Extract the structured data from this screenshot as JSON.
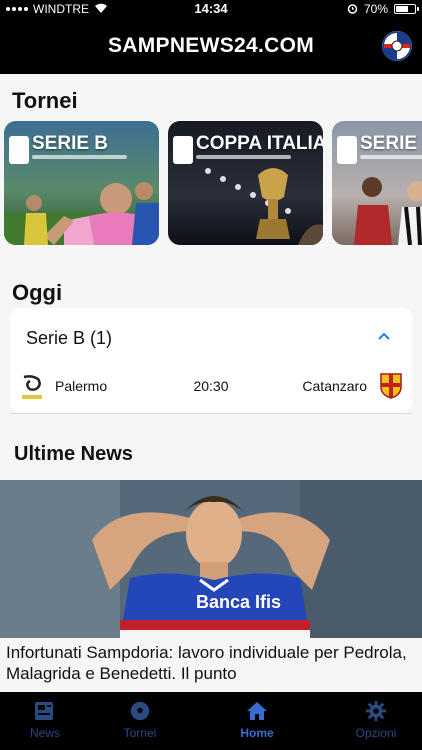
{
  "status_bar": {
    "carrier": "WINDTRE",
    "time": "14:34",
    "battery": "70%",
    "battery_level": 0.7
  },
  "header": {
    "title": "SAMPNEWS24.COM"
  },
  "tournaments": {
    "title": "Tornei",
    "cards": [
      {
        "label": "SERIE B"
      },
      {
        "label": "COPPA ITALIA"
      },
      {
        "label": "SERIE A FE"
      }
    ]
  },
  "today": {
    "title": "Oggi",
    "league": "Serie B (1)",
    "match": {
      "home": "Palermo",
      "time": "20:30",
      "away": "Catanzaro",
      "home_crest_text": "PALERMO"
    }
  },
  "news": {
    "title": "Ultime News",
    "headline": "Infortunati Sampdoria: lavoro individuale per Pedrola, Malagrida e Benedetti. Il punto",
    "image_sponsor": "Banca Ifis"
  },
  "tabs": [
    {
      "label": "News",
      "icon": "newspaper-icon"
    },
    {
      "label": "Tornei",
      "icon": "soccer-ball-icon"
    },
    {
      "label": "Home",
      "icon": "home-icon",
      "active": true
    },
    {
      "label": "Opzioni",
      "icon": "gear-icon"
    }
  ],
  "colors": {
    "header_bg": "#000000",
    "active_tab": "#3a6cd0",
    "inactive_tab": "#2a4a82",
    "accent_chevron": "#2a7be0"
  }
}
